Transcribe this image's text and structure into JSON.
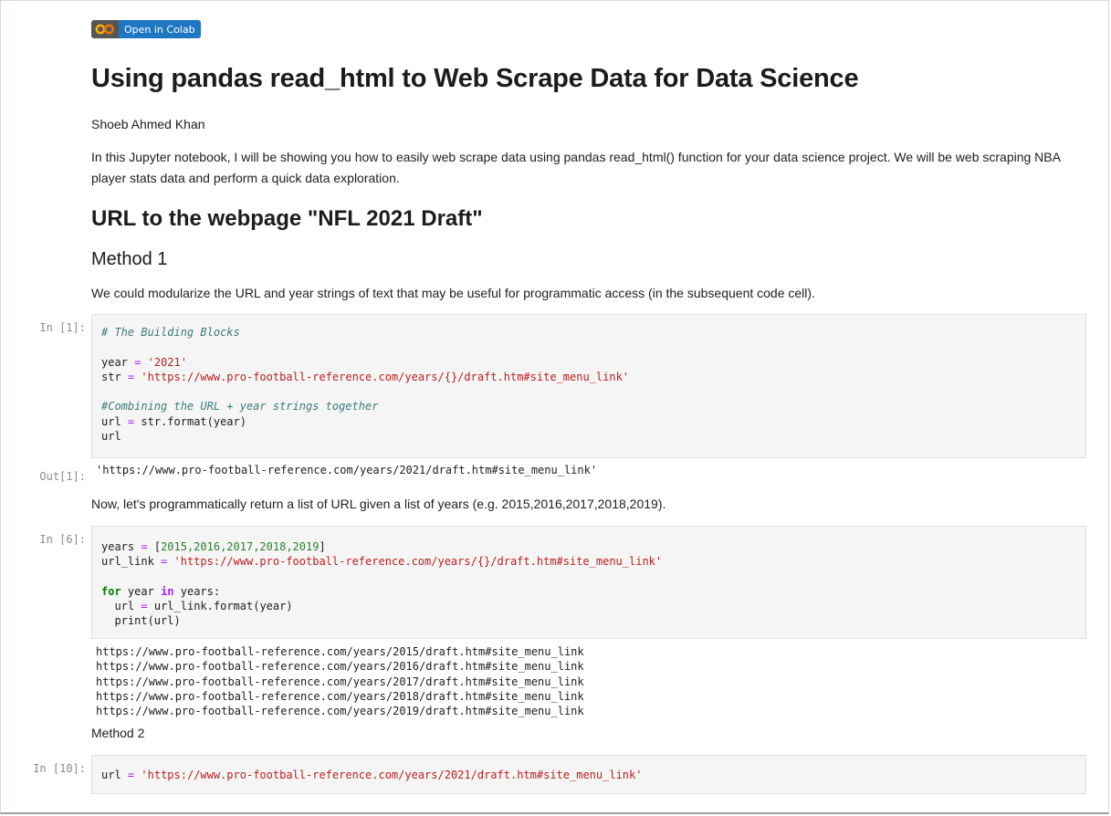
{
  "badge": {
    "logo_text": "CO",
    "label": "Open in Colab"
  },
  "title": "Using pandas read_html to Web Scrape Data for Data Science",
  "author": "Shoeb Ahmed Khan",
  "intro": "In this Jupyter notebook, I will be showing you how to easily web scrape data using pandas read_html() function for your data science project. We will be web scraping NBA player stats data and perform a quick data exploration.",
  "section_heading": "URL to the webpage \"NFL 2021 Draft\"",
  "method1_heading": "Method 1",
  "method1_text": "We could modularize the URL and year strings of text that may be useful for programmatic access (in the subsequent code cell).",
  "cell1": {
    "prompt": "In [1]:",
    "comment1": "# The Building Blocks",
    "year_var": "year",
    "year_eq": "=",
    "year_val": "'2021'",
    "str_var": "str",
    "str_eq": "=",
    "str_val": "'https://www.pro-football-reference.com/years/{}/draft.htm#site_menu_link'",
    "comment2": "#Combining the URL + year strings together",
    "url_var": "url",
    "url_eq": "=",
    "url_expr": "str.format(year)",
    "url_last": "url",
    "out_prompt": "Out[1]:",
    "output": "'https://www.pro-football-reference.com/years/2021/draft.htm#site_menu_link'"
  },
  "method1_text2": "Now, let's programmatically return a list of URL given a list of years (e.g. 2015,2016,2017,2018,2019).",
  "cell2": {
    "prompt": "In [6]:",
    "years_var": "years",
    "years_eq": "=",
    "years_open": "[",
    "years_list": "2015,2016,2017,2018,2019",
    "years_close": "]",
    "link_var": "url_link",
    "link_eq": "=",
    "link_val": "'https://www.pro-football-reference.com/years/{}/draft.htm#site_menu_link'",
    "for_kw": "for",
    "for_var": "year",
    "in_kw": "in",
    "for_iter": "years:",
    "body1_var": "url",
    "body1_eq": "=",
    "body1_expr": "url_link.format(year)",
    "body2": "print(url)",
    "outputs": [
      "https://www.pro-football-reference.com/years/2015/draft.htm#site_menu_link",
      "https://www.pro-football-reference.com/years/2016/draft.htm#site_menu_link",
      "https://www.pro-football-reference.com/years/2017/draft.htm#site_menu_link",
      "https://www.pro-football-reference.com/years/2018/draft.htm#site_menu_link",
      "https://www.pro-football-reference.com/years/2019/draft.htm#site_menu_link"
    ]
  },
  "method2_heading": "Method 2",
  "cell3": {
    "prompt": "In [10]:",
    "url_var": "url",
    "url_eq": "=",
    "url_val": "'https://www.pro-football-reference.com/years/2021/draft.htm#site_menu_link'"
  },
  "colors": {
    "badge_blue": "#1f77c4",
    "badge_gray": "#555555",
    "logo_orange": "#f9ab00",
    "string": "#ba2121",
    "comment": "#3d7a7a",
    "keyword": "#008000",
    "operator": "#aa22ff"
  }
}
